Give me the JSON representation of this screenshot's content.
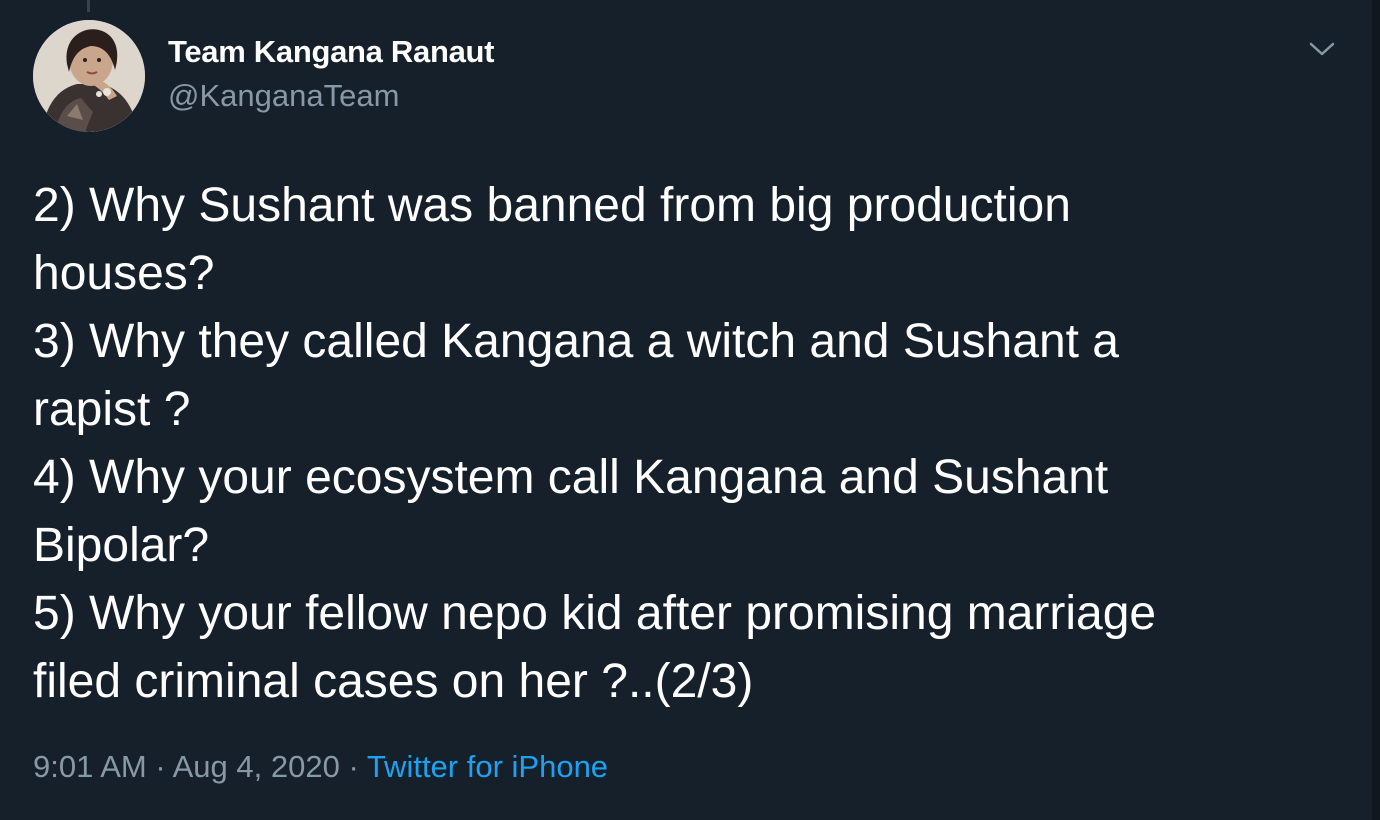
{
  "author": {
    "display_name": "Team Kangana Ranaut",
    "handle": "@KanganaTeam"
  },
  "tweet": {
    "lines": [
      "2) Why Sushant was banned from big production",
      "houses?",
      "3) Why they called Kangana a witch and Sushant a",
      "rapist ?",
      "4) Why your ecosystem call Kangana and Sushant",
      "Bipolar?",
      "5) Why your fellow nepo kid after promising marriage",
      "filed criminal cases on her ?..(2/3)"
    ]
  },
  "meta": {
    "time": "9:01 AM",
    "separator": "·",
    "date": "Aug 4, 2020",
    "source": "Twitter for iPhone"
  },
  "icons": {
    "more_options": "chevron-down-icon"
  },
  "colors": {
    "background": "#15202b",
    "text_primary": "#ffffff",
    "text_secondary": "#8899a6",
    "link": "#1da1f2"
  }
}
